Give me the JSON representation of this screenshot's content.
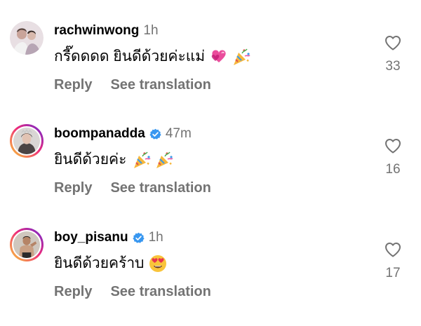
{
  "comments": [
    {
      "username": "rachwinwong",
      "verified": false,
      "time": "1h",
      "text": "กรี๊ดดดด ยินดีด้วยค่ะแม่",
      "emojis": [
        "two-hearts",
        "party-popper"
      ],
      "reply_label": "Reply",
      "translate_label": "See translation",
      "likes": "33"
    },
    {
      "username": "boompanadda",
      "verified": true,
      "time": "47m",
      "text": "ยินดีด้วยค่ะ",
      "emojis": [
        "party-popper",
        "party-popper"
      ],
      "reply_label": "Reply",
      "translate_label": "See translation",
      "likes": "16"
    },
    {
      "username": "boy_pisanu",
      "verified": true,
      "time": "1h",
      "text": "ยินดีด้วยคร้าบ",
      "emojis": [
        "heart-eyes"
      ],
      "reply_label": "Reply",
      "translate_label": "See translation",
      "likes": "17"
    }
  ],
  "colors": {
    "verified": "#3897f0",
    "muted": "#737373"
  }
}
